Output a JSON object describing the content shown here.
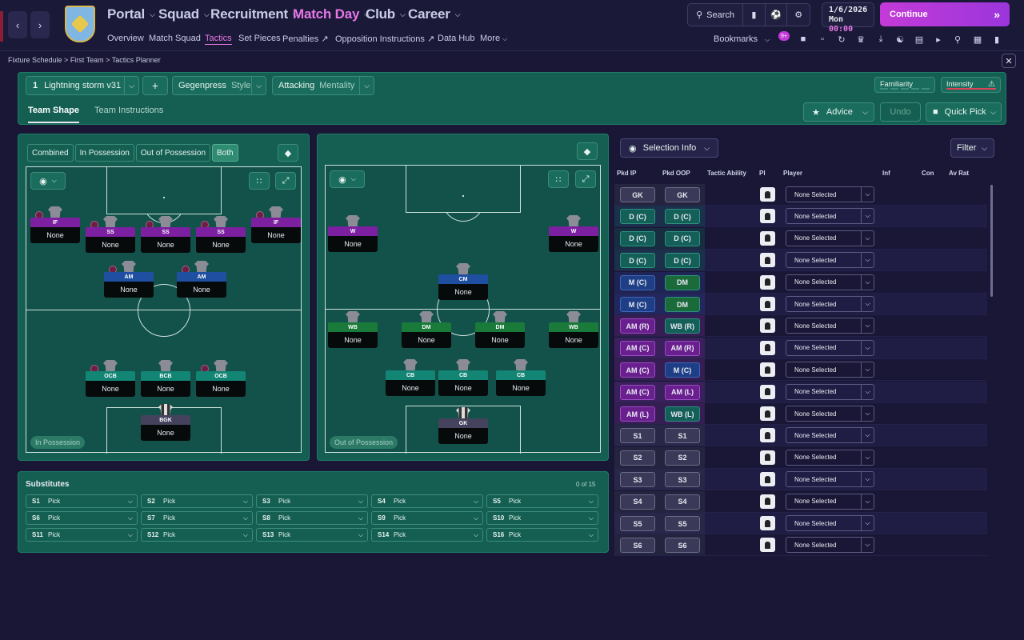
{
  "nav": {
    "main": [
      {
        "label": "Portal",
        "active": false
      },
      {
        "label": "Squad",
        "active": false
      },
      {
        "label": "Recruitment",
        "active": false
      },
      {
        "label": "Match Day",
        "active": true
      },
      {
        "label": "Club",
        "active": false
      },
      {
        "label": "Career",
        "active": false
      }
    ],
    "sub": [
      "Overview",
      "Match Squad",
      "Tactics",
      "Set Pieces",
      "Penalties",
      "Opposition Instructions",
      "Data Hub",
      "More"
    ],
    "sub_active": "Tactics",
    "search_label": "Search",
    "date": "1/6/2026",
    "day": "Mon",
    "time": "00:00",
    "continue_label": "Continue",
    "bookmarks_label": "Bookmarks",
    "notif_count": "9+"
  },
  "breadcrumb": [
    "Fixture Schedule",
    "First Team",
    "Tactics Planner"
  ],
  "tactic": {
    "number": "1",
    "name": "Lightning storm v31",
    "add": "+",
    "style_value": "Gegenpress",
    "style_label": "Style",
    "mentality_value": "Attacking",
    "mentality_label": "Mentality",
    "familiarity_label": "Familiarity",
    "intensity_label": "Intensity",
    "tabs": [
      "Team Shape",
      "Team Instructions"
    ],
    "advice_label": "Advice",
    "undo_label": "Undo",
    "quick_pick_label": "Quick Pick"
  },
  "phase_toggle": [
    "Combined",
    "In Possession",
    "Out of Possession",
    "Both"
  ],
  "phase_selected": "Both",
  "in_possession_label": "In Possession",
  "out_possession_label": "Out of Possession",
  "ip_players": [
    {
      "role": "IF",
      "name": "None",
      "color": "#7c1fa0"
    },
    {
      "role": "SS",
      "name": "None",
      "color": "#7c1fa0"
    },
    {
      "role": "SS",
      "name": "None",
      "color": "#7c1fa0"
    },
    {
      "role": "SS",
      "name": "None",
      "color": "#7c1fa0"
    },
    {
      "role": "IF",
      "name": "None",
      "color": "#7c1fa0"
    },
    {
      "role": "AM",
      "name": "None",
      "color": "#1e4fa0"
    },
    {
      "role": "AM",
      "name": "None",
      "color": "#1e4fa0"
    },
    {
      "role": "OCB",
      "name": "None",
      "color": "#138575"
    },
    {
      "role": "BCB",
      "name": "None",
      "color": "#138575"
    },
    {
      "role": "OCB",
      "name": "None",
      "color": "#138575"
    },
    {
      "role": "BGK",
      "name": "None",
      "color": "#44425c"
    }
  ],
  "oop_players": [
    {
      "role": "W",
      "name": "None",
      "color": "#7c1fa0"
    },
    {
      "role": "W",
      "name": "None",
      "color": "#7c1fa0"
    },
    {
      "role": "CM",
      "name": "None",
      "color": "#1e4fa0"
    },
    {
      "role": "WB",
      "name": "None",
      "color": "#1a7a3a"
    },
    {
      "role": "DM",
      "name": "None",
      "color": "#1a7a3a"
    },
    {
      "role": "DM",
      "name": "None",
      "color": "#1a7a3a"
    },
    {
      "role": "WB",
      "name": "None",
      "color": "#1a7a3a"
    },
    {
      "role": "CB",
      "name": "None",
      "color": "#138575"
    },
    {
      "role": "CB",
      "name": "None",
      "color": "#138575"
    },
    {
      "role": "CB",
      "name": "None",
      "color": "#138575"
    },
    {
      "role": "GK",
      "name": "None",
      "color": "#44425c"
    }
  ],
  "substitutes": {
    "title": "Substitutes",
    "count": "0 of 15",
    "slots": [
      {
        "id": "S1",
        "value": "Pick"
      },
      {
        "id": "S2",
        "value": "Pick"
      },
      {
        "id": "S3",
        "value": "Pick"
      },
      {
        "id": "S4",
        "value": "Pick"
      },
      {
        "id": "S5",
        "value": "Pick"
      },
      {
        "id": "S6",
        "value": "Pick"
      },
      {
        "id": "S7",
        "value": "Pick"
      },
      {
        "id": "S8",
        "value": "Pick"
      },
      {
        "id": "S9",
        "value": "Pick"
      },
      {
        "id": "S10",
        "value": "Pick"
      },
      {
        "id": "S11",
        "value": "Pick"
      },
      {
        "id": "S12",
        "value": "Pick"
      },
      {
        "id": "S13",
        "value": "Pick"
      },
      {
        "id": "S14",
        "value": "Pick"
      },
      {
        "id": "S16",
        "value": "Pick"
      }
    ]
  },
  "selection": {
    "info_label": "Selection Info",
    "filter_label": "Filter",
    "columns": [
      "Pkd IP",
      "Pkd OOP",
      "Tactic Ability",
      "PI",
      "Player",
      "Inf",
      "Con",
      "Av Rat"
    ],
    "rows": [
      {
        "ip": "GK",
        "oop": "GK",
        "player": "None Selected"
      },
      {
        "ip": "D (C)",
        "oop": "D (C)",
        "player": "None Selected"
      },
      {
        "ip": "D (C)",
        "oop": "D (C)",
        "player": "None Selected"
      },
      {
        "ip": "D (C)",
        "oop": "D (C)",
        "player": "None Selected"
      },
      {
        "ip": "M (C)",
        "oop": "DM",
        "player": "None Selected"
      },
      {
        "ip": "M (C)",
        "oop": "DM",
        "player": "None Selected"
      },
      {
        "ip": "AM (R)",
        "oop": "WB (R)",
        "player": "None Selected"
      },
      {
        "ip": "AM (C)",
        "oop": "AM (R)",
        "player": "None Selected"
      },
      {
        "ip": "AM (C)",
        "oop": "M (C)",
        "player": "None Selected"
      },
      {
        "ip": "AM (C)",
        "oop": "AM (L)",
        "player": "None Selected"
      },
      {
        "ip": "AM (L)",
        "oop": "WB (L)",
        "player": "None Selected"
      },
      {
        "ip": "S1",
        "oop": "S1",
        "player": "None Selected"
      },
      {
        "ip": "S2",
        "oop": "S2",
        "player": "None Selected"
      },
      {
        "ip": "S3",
        "oop": "S3",
        "player": "None Selected"
      },
      {
        "ip": "S4",
        "oop": "S4",
        "player": "None Selected"
      },
      {
        "ip": "S5",
        "oop": "S5",
        "player": "None Selected"
      },
      {
        "ip": "S6",
        "oop": "S6",
        "player": "None Selected"
      }
    ]
  },
  "colors": {
    "accent": "#e678e6",
    "panel": "#145f52",
    "pos_gk": "#3a3a58",
    "pos_def": "#145f58",
    "pos_mid": "#1e3f86",
    "pos_am": "#6a1f8f",
    "pos_dm": "#1a6a3a"
  }
}
